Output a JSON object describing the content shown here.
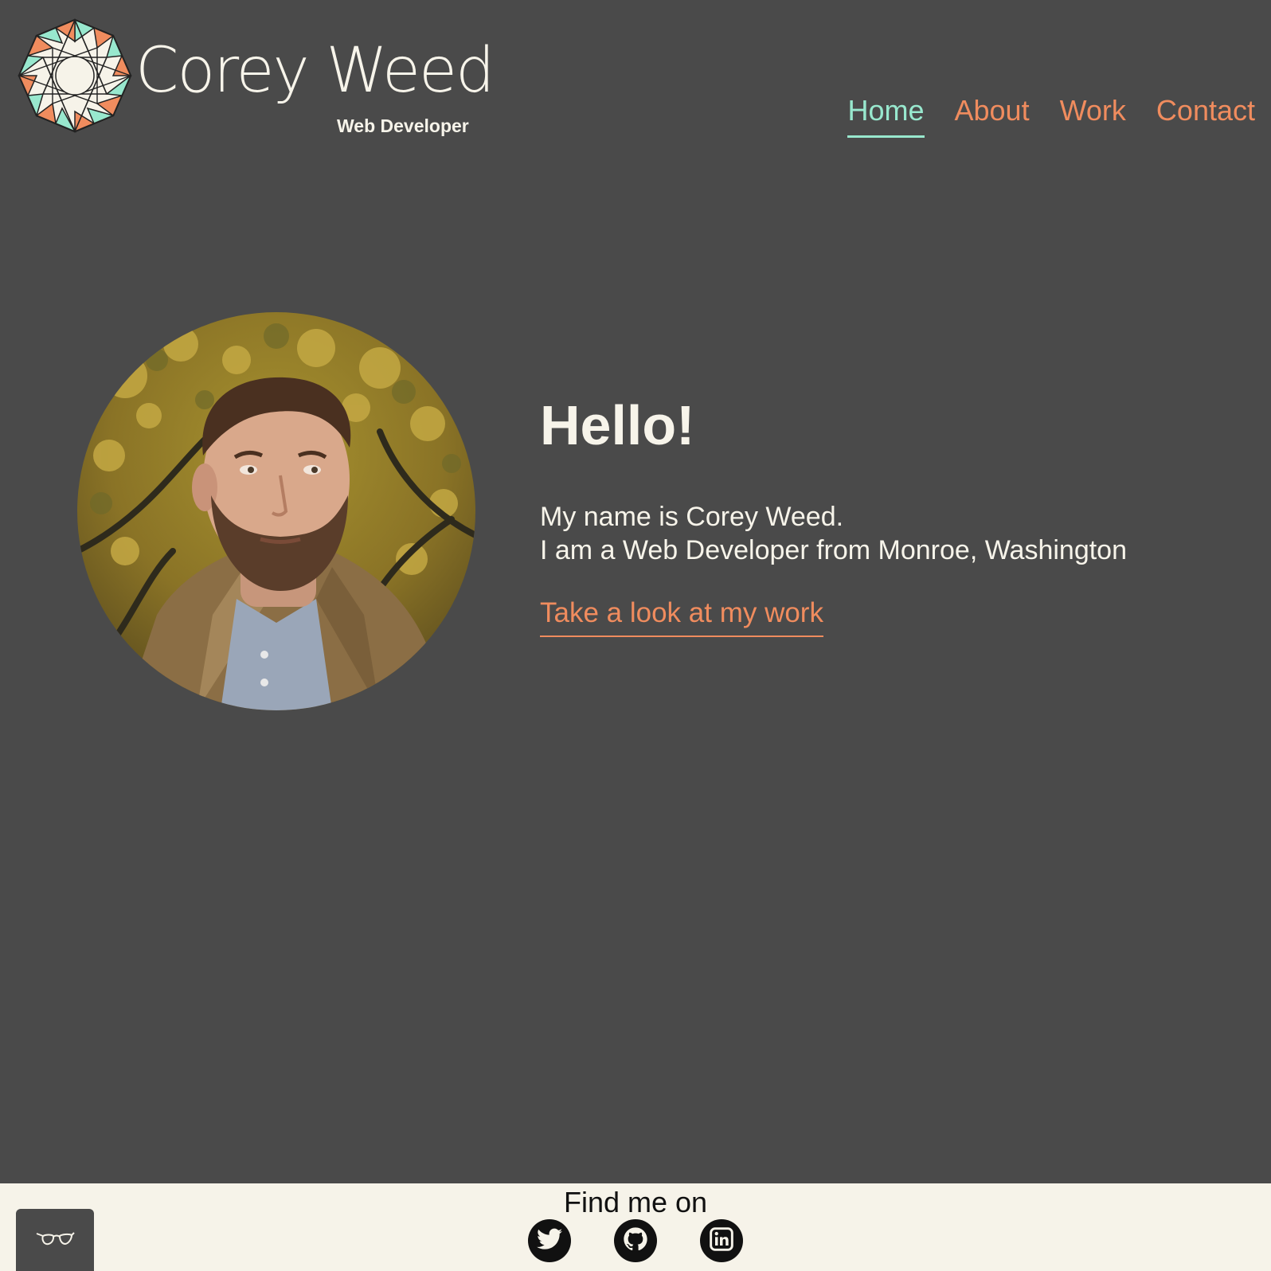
{
  "header": {
    "brand_name": "Corey Weed",
    "brand_subtitle": "Web Developer",
    "nav": [
      {
        "label": "Home",
        "active": true
      },
      {
        "label": "About",
        "active": false
      },
      {
        "label": "Work",
        "active": false
      },
      {
        "label": "Contact",
        "active": false
      }
    ]
  },
  "hero": {
    "heading": "Hello!",
    "line1": "My name is Corey Weed.",
    "line2": "I am a Web Developer from Monroe, Washington",
    "cta": "Take a look at my work"
  },
  "footer": {
    "title": "Find me on",
    "socials": [
      {
        "icon": "twitter-icon"
      },
      {
        "icon": "github-icon"
      },
      {
        "icon": "linkedin-icon"
      }
    ]
  },
  "accessibility_button": {
    "icon": "glasses-icon"
  },
  "colors": {
    "background": "#4a4a4a",
    "accent_mint": "#98e8ce",
    "accent_orange": "#f08c5e",
    "cream": "#f7f4ea",
    "footer_bg": "#f6f3e9"
  }
}
